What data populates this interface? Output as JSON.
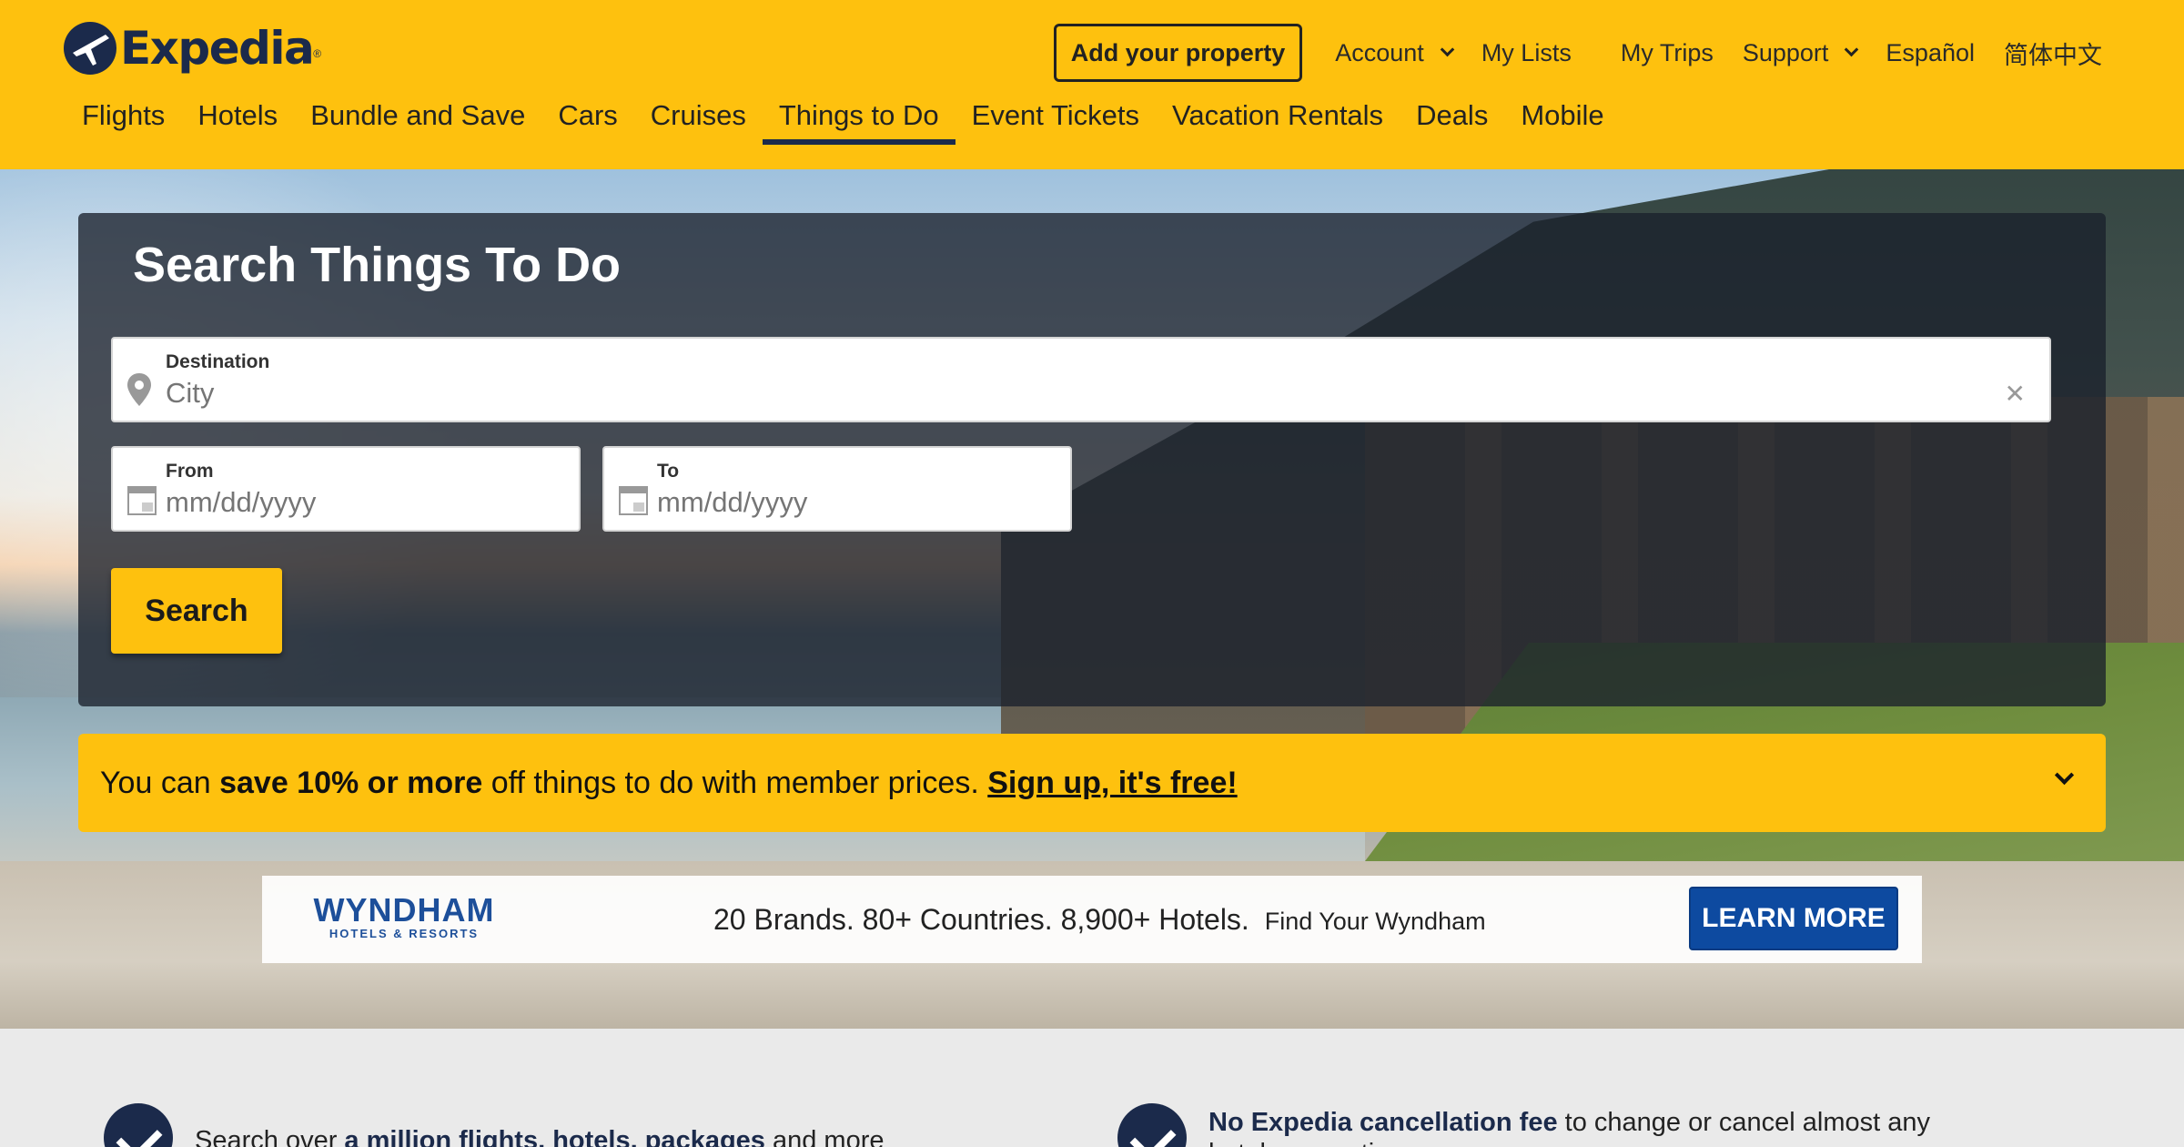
{
  "header": {
    "logo_text": "Expedia",
    "add_property": "Add your property",
    "top_links": {
      "account": "Account",
      "my_lists": "My Lists",
      "my_trips": "My Trips",
      "support": "Support",
      "espanol": "Español",
      "chinese": "简体中文"
    },
    "nav": [
      "Flights",
      "Hotels",
      "Bundle and Save",
      "Cars",
      "Cruises",
      "Things to Do",
      "Event Tickets",
      "Vacation Rentals",
      "Deals",
      "Mobile"
    ],
    "active_nav": "Things to Do"
  },
  "search": {
    "title": "Search Things To Do",
    "destination_label": "Destination",
    "destination_placeholder": "City",
    "from_label": "From",
    "from_placeholder": "mm/dd/yyyy",
    "to_label": "To",
    "to_placeholder": "mm/dd/yyyy",
    "button": "Search"
  },
  "promo": {
    "pre": "You can ",
    "bold": "save 10% or more",
    "post": " off things to do with member prices. ",
    "link": "Sign up, it's free!"
  },
  "ad": {
    "brand": "WYNDHAM",
    "brand_sub": "HOTELS & RESORTS",
    "headline": "20 Brands. 80+ Countries. 8,900+ Hotels.",
    "tagline": "Find Your Wyndham",
    "button": "LEARN MORE"
  },
  "benefits": [
    {
      "pre": "Search over ",
      "bold": "a million flights, hotels, packages",
      "post": " and more"
    },
    {
      "pre": "",
      "bold": "No Expedia cancellation fee",
      "post": " to change or cancel almost any hotel reservation"
    }
  ],
  "colors": {
    "brand_yellow": "#fec10e",
    "brand_navy": "#1b2a4b",
    "ad_blue": "#0d4aa0"
  }
}
